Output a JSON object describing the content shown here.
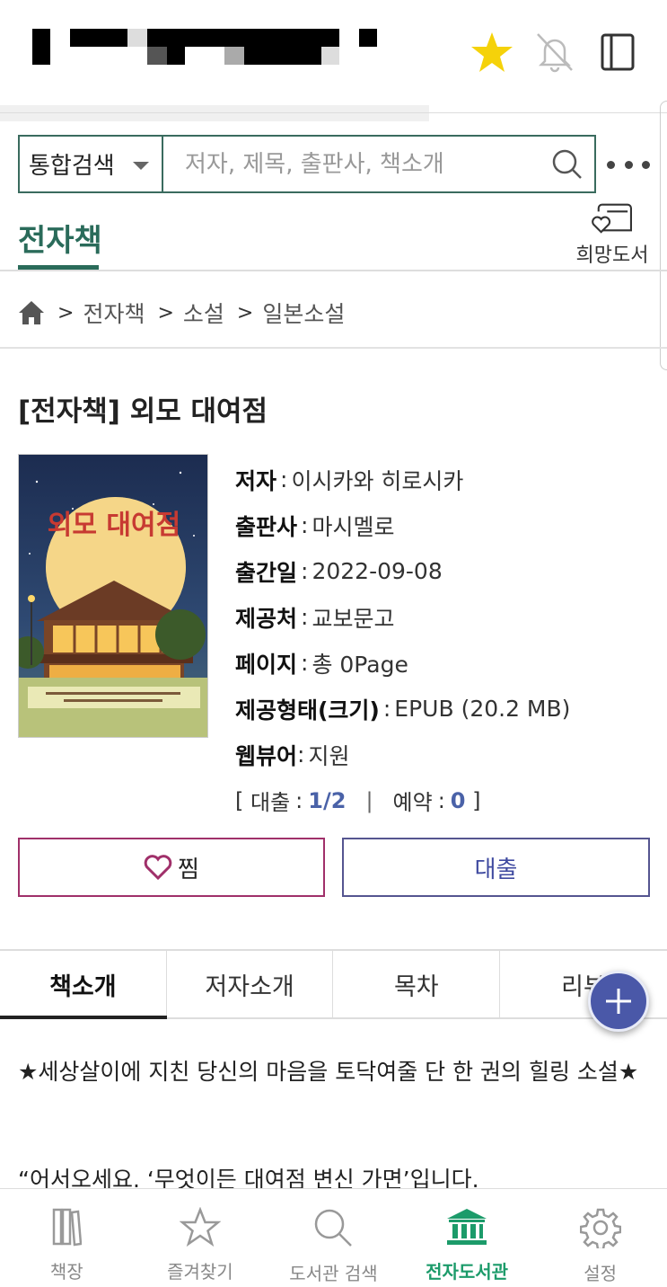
{
  "colors": {
    "accent_green": "#2a6b5a",
    "nav_active_green": "#1c9b6a",
    "star_yellow": "#f5d20a",
    "wish_border": "#a0306a",
    "loan_border": "#555590",
    "count_blue": "#4a62a8",
    "fab_blue": "#4a58a8"
  },
  "header": {
    "icons": [
      "star-icon",
      "bell-off-icon",
      "book-panel-icon"
    ]
  },
  "search": {
    "scope": "통합검색",
    "placeholder": "저자, 제목, 출판사, 책소개",
    "value": ""
  },
  "section": {
    "tab": "전자책",
    "wish_library_label": "희망도서"
  },
  "breadcrumb": {
    "items": [
      "전자책",
      "소설",
      "일본소설"
    ]
  },
  "book": {
    "title": "[전자책] 외모 대여점",
    "cover_title_text": "외모 대여점",
    "info": [
      {
        "key": "저자",
        "value": "이시카와 히로시카"
      },
      {
        "key": "출판사",
        "value": "마시멜로"
      },
      {
        "key": "출간일",
        "value": "2022-09-08"
      },
      {
        "key": "제공처",
        "value": "교보문고"
      },
      {
        "key": "페이지",
        "value": "총 0Page"
      },
      {
        "key": "제공형태(크기)",
        "value": "EPUB (20.2 MB)"
      },
      {
        "key": "웹뷰어",
        "value": "지원"
      }
    ],
    "loan_label": "대출",
    "loan_count": "1/2",
    "reserve_label": "예약",
    "reserve_count": "0"
  },
  "actions": {
    "wish_label": "찜",
    "loan_label": "대출"
  },
  "tabs": [
    "책소개",
    "저자소개",
    "목차",
    "리뷰"
  ],
  "intro": {
    "line1": "★세상살이에 지친 당신의 마음을 토닥여줄 단 한 권의 힐링 소설★",
    "line2": "“어서오세요. ‘무엇이든 대여점 변신 가면’입니다."
  },
  "bottom_nav": [
    {
      "label": "책장",
      "icon": "bookshelf-icon"
    },
    {
      "label": "즐겨찾기",
      "icon": "star-outline-icon"
    },
    {
      "label": "도서관 검색",
      "icon": "search-icon"
    },
    {
      "label": "전자도서관",
      "icon": "library-icon",
      "active": true
    },
    {
      "label": "설정",
      "icon": "gear-icon"
    }
  ]
}
